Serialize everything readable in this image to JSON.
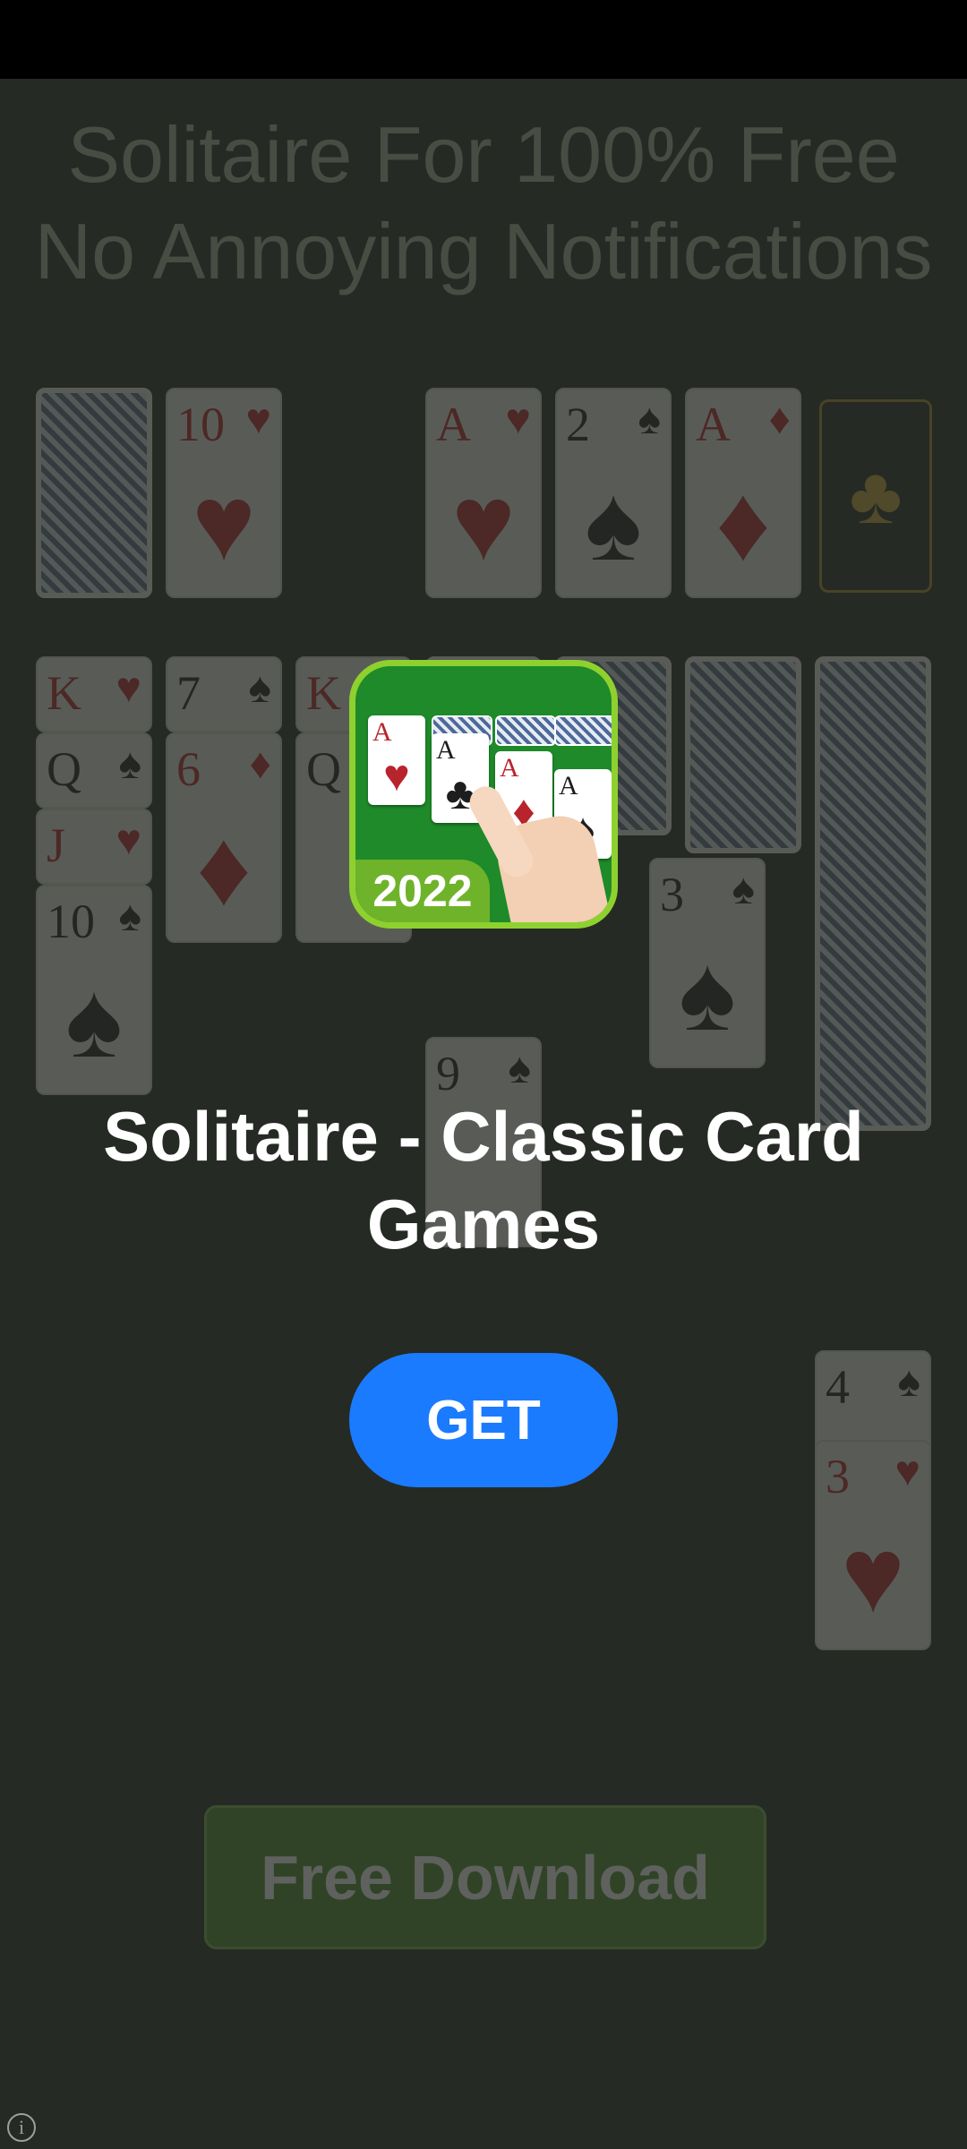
{
  "background_ad": {
    "headline_line1": "Solitaire For 100% Free",
    "headline_line2": "No Annoying Notifications",
    "download_label": "Free Download",
    "cards": {
      "c10h_rank": "10",
      "c10h_suit": "♥",
      "ah_rank": "A",
      "ah_suit": "♥",
      "two_s_rank": "2",
      "two_s_suit": "♠",
      "ad_rank": "A",
      "ad_suit": "♦",
      "club_slot": "♣",
      "k_h_rank": "K",
      "k_h_suit": "♥",
      "q_s_rank": "Q",
      "q_s_suit": "♠",
      "j_h_rank": "J",
      "j_h_suit": "♥",
      "t_s_rank": "10",
      "t_s_suit": "♠",
      "seven_s_rank": "7",
      "seven_s_suit": "♠",
      "six_d_rank": "6",
      "six_d_suit": "♦",
      "k_d_rank": "K",
      "k_d_suit": "♦",
      "q_rank": "Q",
      "three_s_rank": "3",
      "three_s_suit": "♠",
      "nine_s_rank": "9",
      "nine_s_suit": "♠",
      "four_s_rank": "4",
      "four_s_suit": "♠",
      "three_h_rank": "3",
      "three_h_suit": "♥"
    }
  },
  "app": {
    "icon_badge": "2022",
    "icon_cards": [
      "A",
      "A",
      "A",
      "A"
    ],
    "title": "Solitaire - Classic Card Games",
    "get_label": "GET"
  },
  "info_icon": "i",
  "colors": {
    "get_button": "#1a7bff",
    "overlay_bg": "#262a24",
    "icon_green": "#1e8a2a",
    "icon_border": "#8ed12f"
  }
}
